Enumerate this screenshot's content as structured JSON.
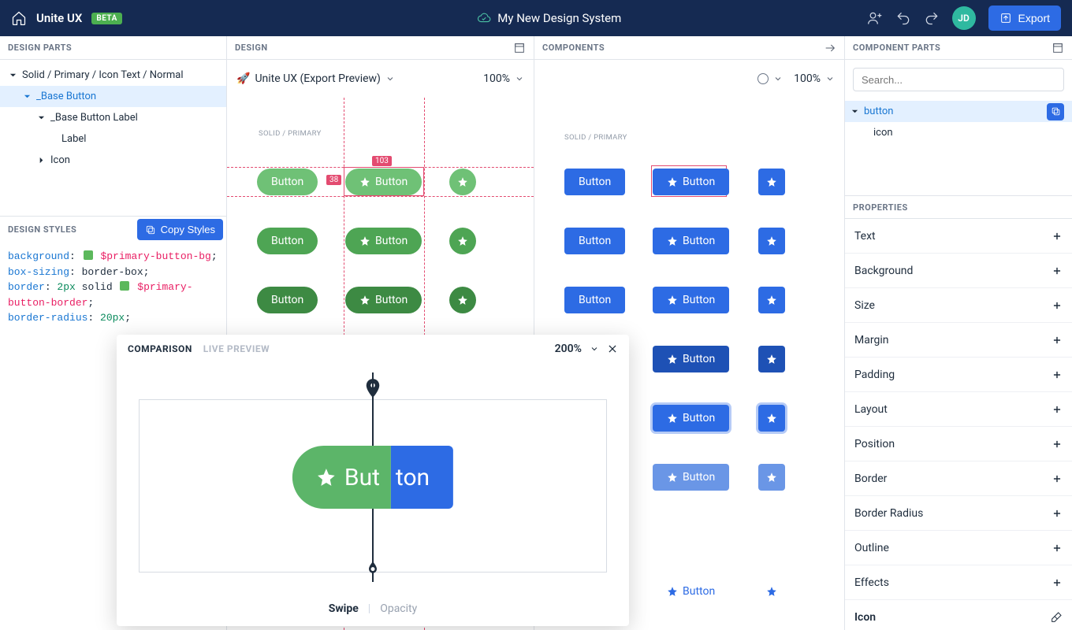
{
  "topbar": {
    "app_title": "Unite UX",
    "beta": "BETA",
    "project_name": "My New Design System",
    "avatar_initials": "JD",
    "export_label": "Export"
  },
  "panels": {
    "design_parts": "DESIGN PARTS",
    "design": "DESIGN",
    "components": "COMPONENTS",
    "component_parts": "COMPONENT PARTS",
    "design_styles": "DESIGN STYLES",
    "properties": "PROPERTIES",
    "copy_styles": "Copy Styles"
  },
  "design_parts_tree": {
    "root": "Solid / Primary / Icon Text / Normal",
    "base_button": "_Base Button",
    "base_button_label": "_Base Button Label",
    "label": "Label",
    "icon": "Icon"
  },
  "styles_code": {
    "l1a": "background",
    "l1b": "$primary-button-bg",
    "l2a": "box-sizing",
    "l2b": "border-box",
    "l3a": "border",
    "l3b": "2px",
    "l3c": "solid",
    "l3d": "$primary-",
    "l4": "button-border",
    "l5a": "border-radius",
    "l5b": "20px"
  },
  "design_canvas": {
    "file_label": "Unite UX (Export Preview)",
    "zoom": "100%",
    "section_label": "SOLID / PRIMARY",
    "meas_top": "103",
    "meas_side": "38",
    "button_text": "Button"
  },
  "components_canvas": {
    "zoom": "100%",
    "section_label": "SOLID / PRIMARY",
    "button_text": "Button"
  },
  "comparison": {
    "tab_comparison": "COMPARISON",
    "tab_live": "LIVE PREVIEW",
    "zoom": "200%",
    "left_text": "But",
    "right_text": "ton",
    "mode_swipe": "Swipe",
    "mode_opacity": "Opacity"
  },
  "component_parts": {
    "search_placeholder": "Search...",
    "button": "button",
    "icon": "icon"
  },
  "properties": {
    "items": [
      "Text",
      "Background",
      "Size",
      "Margin",
      "Padding",
      "Layout",
      "Position",
      "Border",
      "Border Radius",
      "Outline",
      "Effects"
    ],
    "icon_label": "Icon"
  }
}
